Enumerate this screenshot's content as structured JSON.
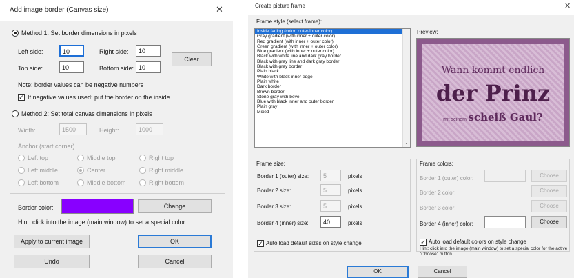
{
  "canvas_dialog": {
    "title": "Add image border (Canvas size)",
    "close_glyph": "✕",
    "method1_label": "Method 1: Set border dimensions in pixels",
    "left_label": "Left side:",
    "left_value": "10",
    "right_label": "Right side:",
    "right_value": "10",
    "top_label": "Top side:",
    "top_value": "10",
    "bottom_label": "Bottom side:",
    "bottom_value": "10",
    "clear_label": "Clear",
    "note": "Note: border values can be negative numbers",
    "negative_check_mark": "✓",
    "negative_label": "If negative values used: put the border on the inside",
    "method2_label": "Method 2: Set total canvas dimensions in pixels",
    "width_label": "Width:",
    "width_value": "1500",
    "height_label": "Height:",
    "height_value": "1000",
    "anchor_label": "Anchor (start corner)",
    "anchors": [
      "Left top",
      "Middle top",
      "Right top",
      "Left middle",
      "Center",
      "Right middle",
      "Left bottom",
      "Middle bottom",
      "Right bottom"
    ],
    "border_color_label": "Border color:",
    "border_color": "#8800ff",
    "change_label": "Change",
    "hint": "Hint: click into the image (main window) to set a special color",
    "apply_label": "Apply to current image",
    "ok_label": "OK",
    "undo_label": "Undo",
    "cancel_label": "Cancel"
  },
  "frame_dialog": {
    "title": "Create picture frame",
    "close_glyph": "✕",
    "style_label": "Frame style (select frame):",
    "styles": [
      "Inside fading (color: outer/inner color)",
      "Gray gradient (with inner + outer color)",
      "Red gradient (with inner + outer color)",
      "Green gradient (with inner + outer color)",
      "Blue gradient (with inner + outer color)",
      "Black with white line and dark gray border",
      "Black with gray line and dark gray border",
      "Black with gray border",
      "Plain black",
      "White with black inner edge",
      "Plain white",
      "Dark border",
      "Brown border",
      "Stone gray with bevel",
      "Blue with black inner and outer border",
      "Plain gray",
      "Mixed"
    ],
    "preview_label": "Preview:",
    "preview_line1": "Wann kommt endlich",
    "preview_line2": "der Prinz",
    "preview_line3a": "mit seinem",
    "preview_line3b": "scheiß Gaul?",
    "size_label": "Frame size:",
    "border1_label": "Border 1 (outer) size:",
    "border1_value": "5",
    "border2_label": "Border 2 size:",
    "border2_value": "5",
    "border3_label": "Border 3 size:",
    "border3_value": "5",
    "border4_label": "Border 4 (inner) size:",
    "border4_value": "40",
    "unit": "pixels",
    "colors_label": "Frame colors:",
    "color1_label": "Border 1 (outer) color:",
    "color2_label": "Border 2 color:",
    "color3_label": "Border 3 color:",
    "color4_label": "Border 4 (inner) color:",
    "choose_label": "Choose",
    "auto_size_check_mark": "✓",
    "auto_size_label": "Auto load default sizes on style change",
    "auto_color_check_mark": "✓",
    "auto_color_label": "Auto load default colors on style change",
    "hint": "Hint: click into the image (main window) to set a special color for the active \"Choose\" button",
    "ok_label": "OK",
    "cancel_label": "Cancel"
  }
}
